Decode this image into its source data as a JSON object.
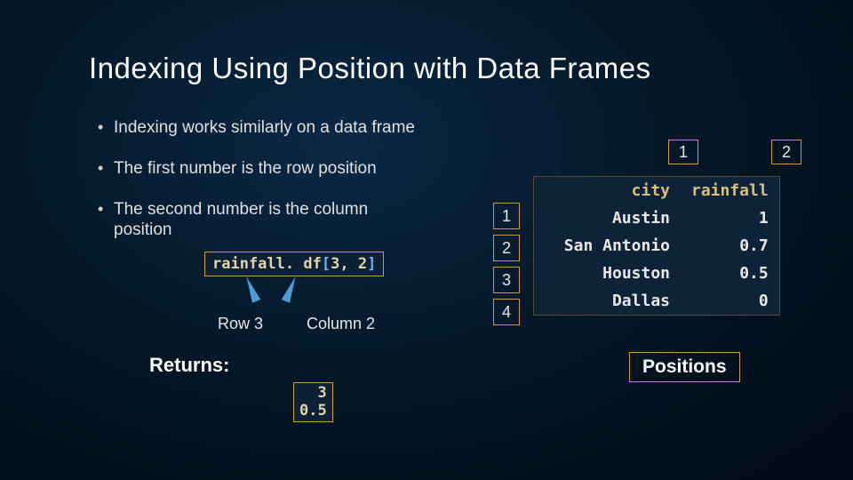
{
  "title": "Indexing Using Position with Data Frames",
  "bullets": {
    "b1": "Indexing works similarly on a data frame",
    "b2": "The first number is the row position",
    "b3": "The second number is the column position"
  },
  "code": {
    "ident": "rainfall. df",
    "lbrack": "[",
    "arg1": "3",
    "comma": ", ",
    "arg2": "2",
    "rbrack": "]"
  },
  "labels": {
    "row": "Row 3",
    "col": "Column 2",
    "returns": "Returns:",
    "positions": "Positions"
  },
  "returns": {
    "idx": "3",
    "val": "0.5"
  },
  "colpos": {
    "c1": "1",
    "c2": "2"
  },
  "rowpos": {
    "r1": "1",
    "r2": "2",
    "r3": "3",
    "r4": "4"
  },
  "table": {
    "header": {
      "city": "city",
      "rain": "rainfall"
    },
    "rows": [
      {
        "city": "Austin",
        "rain": "1"
      },
      {
        "city": "San Antonio",
        "rain": "0.7"
      },
      {
        "city": "Houston",
        "rain": "0.5"
      },
      {
        "city": "Dallas",
        "rain": "0"
      }
    ]
  }
}
